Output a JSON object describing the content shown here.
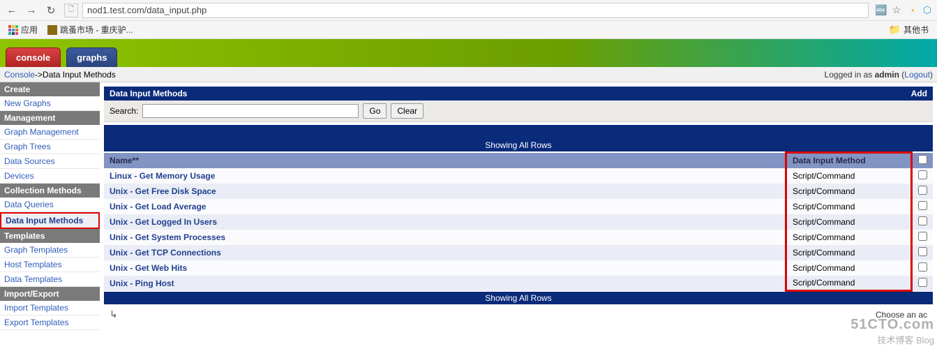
{
  "browser": {
    "url": "nod1.test.com/data_input.php",
    "apps_label": "应用",
    "bookmark1": "跳蚤市场 - 重庆驴...",
    "other_bookmarks": "其他书"
  },
  "tabs": {
    "console": "console",
    "graphs": "graphs"
  },
  "breadcrumb": {
    "console": "Console",
    "sep": " -> ",
    "page": "Data Input Methods",
    "logged_in_prefix": "Logged in as ",
    "user": "admin",
    "logout": "Logout"
  },
  "sidebar": {
    "groups": [
      {
        "title": "Create",
        "items": [
          {
            "label": "New Graphs"
          }
        ]
      },
      {
        "title": "Management",
        "items": [
          {
            "label": "Graph Management"
          },
          {
            "label": "Graph Trees"
          },
          {
            "label": "Data Sources"
          },
          {
            "label": "Devices"
          }
        ]
      },
      {
        "title": "Collection Methods",
        "items": [
          {
            "label": "Data Queries"
          },
          {
            "label": "Data Input Methods",
            "active": true
          }
        ]
      },
      {
        "title": "Templates",
        "items": [
          {
            "label": "Graph Templates"
          },
          {
            "label": "Host Templates"
          },
          {
            "label": "Data Templates"
          }
        ]
      },
      {
        "title": "Import/Export",
        "items": [
          {
            "label": "Import Templates"
          },
          {
            "label": "Export Templates"
          }
        ]
      }
    ]
  },
  "panel": {
    "title": "Data Input Methods",
    "add": "Add",
    "search_label": "Search:",
    "go": "Go",
    "clear": "Clear",
    "showing": "Showing All Rows",
    "columns": {
      "name": "Name**",
      "method": "Data Input Method"
    },
    "rows": [
      {
        "name": "Linux - Get Memory Usage",
        "method": "Script/Command"
      },
      {
        "name": "Unix - Get Free Disk Space",
        "method": "Script/Command"
      },
      {
        "name": "Unix - Get Load Average",
        "method": "Script/Command"
      },
      {
        "name": "Unix - Get Logged In Users",
        "method": "Script/Command"
      },
      {
        "name": "Unix - Get System Processes",
        "method": "Script/Command"
      },
      {
        "name": "Unix - Get TCP Connections",
        "method": "Script/Command"
      },
      {
        "name": "Unix - Get Web Hits",
        "method": "Script/Command"
      },
      {
        "name": "Unix - Ping Host",
        "method": "Script/Command"
      }
    ],
    "footer_action": "Choose an ac"
  },
  "watermark": {
    "line1": "51CTO.com",
    "line2": "技术博客  Blog"
  }
}
